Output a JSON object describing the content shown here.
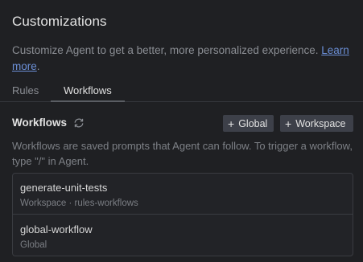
{
  "header": {
    "title": "Customizations",
    "subtitle": "Customize Agent to get a better, more personalized experience. ",
    "learn_more": "Learn more",
    "period": "."
  },
  "tabs": [
    {
      "label": "Rules",
      "active": false
    },
    {
      "label": "Workflows",
      "active": true
    }
  ],
  "workflows": {
    "title": "Workflows",
    "refresh_icon": "refresh-icon",
    "global_button": "Global",
    "workspace_button": "Workspace",
    "description": "Workflows are saved prompts that Agent can follow. To trigger a workflow, type \"/\" in Agent.",
    "items": [
      {
        "name": "generate-unit-tests",
        "meta": "Workspace · rules-workflows"
      },
      {
        "name": "global-workflow",
        "meta": "Global"
      }
    ]
  },
  "colors": {
    "background": "#1f2023",
    "link": "#6b8fd6",
    "button": "#3d4049"
  }
}
